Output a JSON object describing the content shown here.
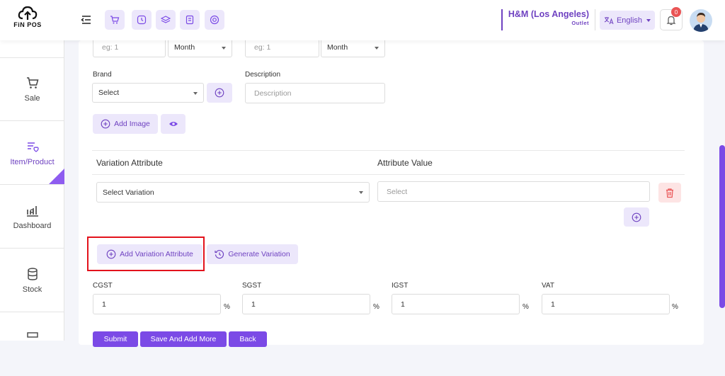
{
  "app": {
    "logo_text": "FiN POS"
  },
  "header": {
    "outlet_name": "H&M (Los Angeles)",
    "outlet_type": "Outlet",
    "language": "English",
    "notification_count": "0"
  },
  "sidebar": {
    "items": [
      {
        "label": "Sale",
        "icon": "cart-icon"
      },
      {
        "label": "Item/Product",
        "icon": "product-list-icon"
      },
      {
        "label": "Dashboard",
        "icon": "chart-icon"
      },
      {
        "label": "Stock",
        "icon": "database-icon"
      }
    ]
  },
  "form": {
    "row0": {
      "input1_placeholder": "eg: 1",
      "select1_value": "Month",
      "input2_placeholder": "eg: 1",
      "select2_value": "Month"
    },
    "brand_label": "Brand",
    "brand_value": "Select",
    "description_label": "Description",
    "description_placeholder": "Description",
    "add_image_label": "Add Image",
    "variation_header": "Variation Attribute",
    "attribute_value_header": "Attribute Value",
    "variation_select": "Select Variation",
    "attribute_value_placeholder": "Select",
    "add_variation_label": "Add Variation Attribute",
    "generate_variation_label": "Generate Variation",
    "taxes": [
      {
        "label": "CGST",
        "value": "1",
        "unit": "%"
      },
      {
        "label": "SGST",
        "value": "1",
        "unit": "%"
      },
      {
        "label": "IGST",
        "value": "1",
        "unit": "%"
      },
      {
        "label": "VAT",
        "value": "1",
        "unit": "%"
      }
    ],
    "buttons": {
      "submit": "Submit",
      "save_add_more": "Save And Add More",
      "back": "Back"
    }
  },
  "colors": {
    "accent": "#6f42c1",
    "accent_light": "#ece7fb",
    "danger": "#ea5455",
    "highlight": "#e3121c"
  }
}
